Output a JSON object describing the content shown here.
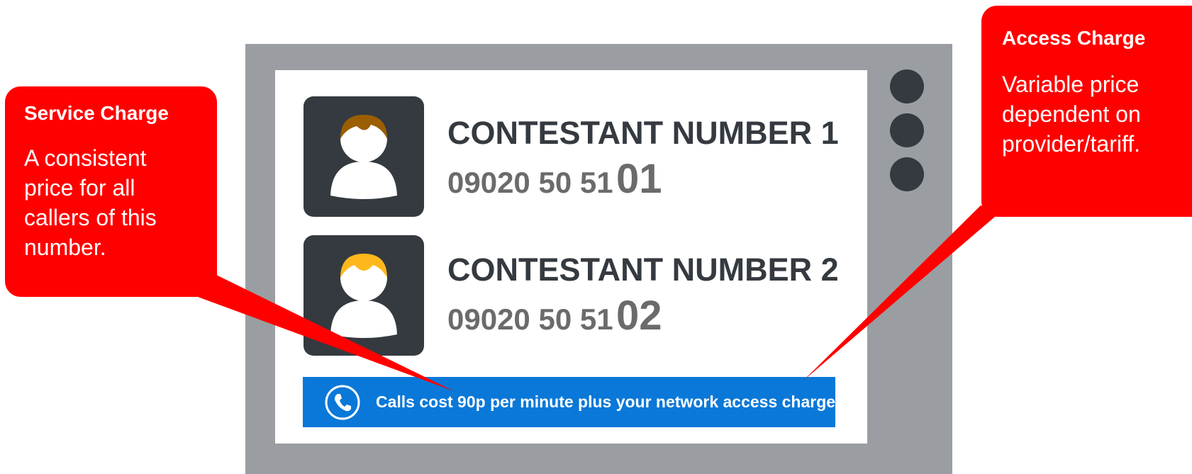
{
  "contestants": [
    {
      "name": "CONTESTANT NUMBER 1",
      "number_base": "09020 50 51",
      "number_suffix": "01",
      "hair_color": "#9b5e00"
    },
    {
      "name": "CONTESTANT NUMBER 2",
      "number_base": "09020 50 51",
      "number_suffix": "02",
      "hair_color": "#ffb81c"
    }
  ],
  "banner": {
    "icon": "phone-icon",
    "text": "Calls cost 90p per minute plus your network access charge.",
    "color": "#0a78d8"
  },
  "callouts": {
    "service": {
      "title": "Service Charge",
      "body": "A consistent price for all callers of this number.",
      "color": "#ff0000"
    },
    "access": {
      "title": "Access Charge",
      "body": "Variable price dependent on provider/tariff.",
      "color": "#ff0000"
    }
  },
  "colors": {
    "tv_frame": "#9a9ea2",
    "dark": "#343a40",
    "number_gray": "#6b6b6b"
  }
}
